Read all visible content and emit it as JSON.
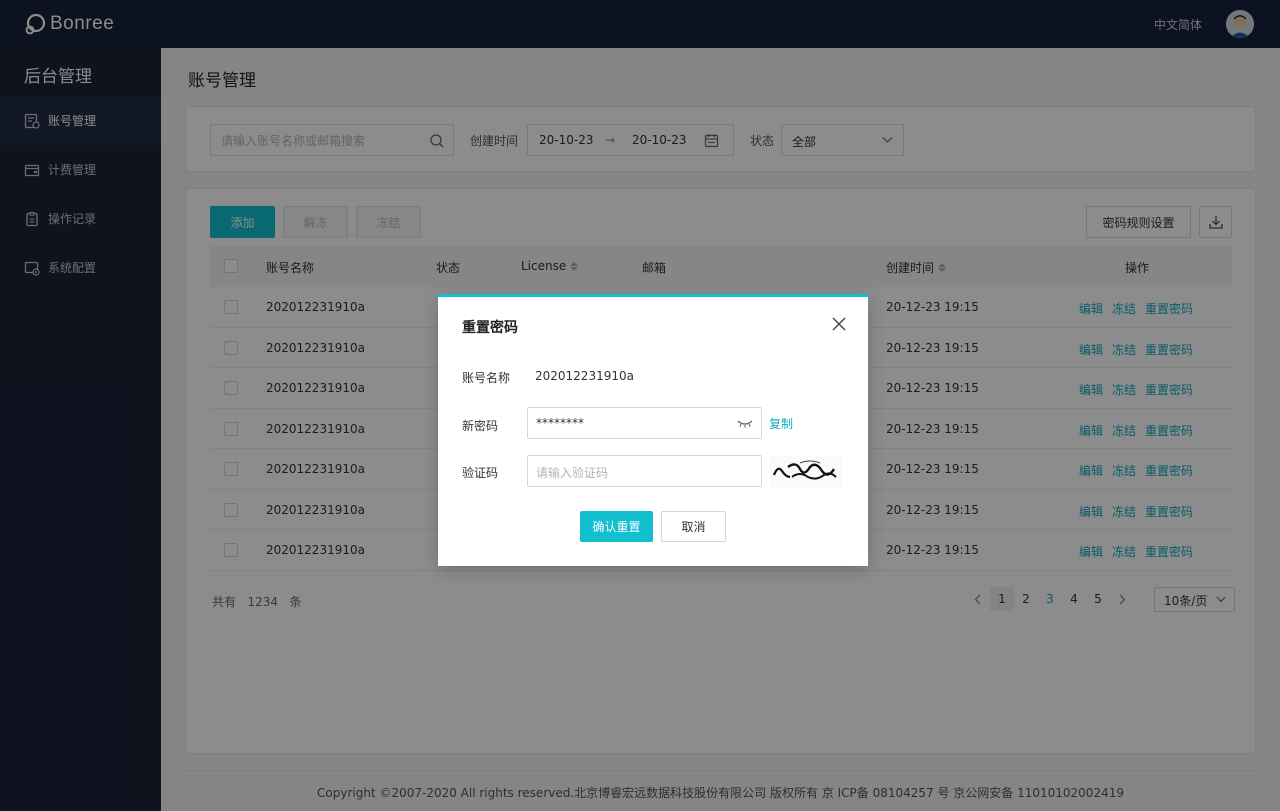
{
  "header": {
    "logo_text": "Bonree",
    "language": "中文简体"
  },
  "sidebar": {
    "title": "后台管理",
    "items": [
      {
        "label": "账号管理",
        "icon": "account-icon",
        "active": true
      },
      {
        "label": "计费管理",
        "icon": "wallet-icon",
        "active": false
      },
      {
        "label": "操作记录",
        "icon": "clipboard-icon",
        "active": false
      },
      {
        "label": "系统配置",
        "icon": "settings-icon",
        "active": false
      }
    ]
  },
  "main": {
    "title": "账号管理",
    "filters": {
      "search_placeholder": "请输入账号名称或邮箱搜索",
      "created_label": "创建时间",
      "date_start": "20-10-23",
      "date_sep": "→",
      "date_end": "20-10-23",
      "status_label": "状态",
      "status_value": "全部"
    },
    "toolbar": {
      "add": "添加",
      "unfreeze": "解冻",
      "freeze": "冻结",
      "password_rules": "密码规则设置"
    },
    "table": {
      "columns": [
        "账号名称",
        "状态",
        "License",
        "邮箱",
        "创建时间",
        "操作"
      ],
      "rows": [
        {
          "name": "202012231910a",
          "created": "20-12-23 19:15"
        },
        {
          "name": "202012231910a",
          "created": "20-12-23 19:15"
        },
        {
          "name": "202012231910a",
          "created": "20-12-23 19:15"
        },
        {
          "name": "202012231910a",
          "created": "20-12-23 19:15"
        },
        {
          "name": "202012231910a",
          "created": "20-12-23 19:15"
        },
        {
          "name": "202012231910a",
          "created": "20-12-23 19:15"
        },
        {
          "name": "202012231910a",
          "created": "20-12-23 19:15"
        }
      ],
      "actions": [
        "编辑",
        "冻结",
        "重置密码"
      ]
    },
    "pagination": {
      "total_prefix": "共有",
      "total": "1234",
      "total_suffix": "条",
      "pages": [
        "1",
        "2",
        "3",
        "4",
        "5"
      ],
      "current_page": "1",
      "page_size": "10条/页"
    },
    "footer": "Copyright ©2007-2020 All rights reserved.北京博睿宏远数据科技股份有限公司 版权所有 京 ICP备 08104257 号 京公网安备 11010102002419"
  },
  "modal": {
    "title": "重置密码",
    "account_label": "账号名称",
    "account_value": "202012231910a",
    "new_password_label": "新密码",
    "new_password_value": "********",
    "copy": "复制",
    "captcha_label": "验证码",
    "captcha_placeholder": "请输入验证码",
    "confirm": "确认重置",
    "cancel": "取消"
  },
  "colors": {
    "accent": "#12bfcf",
    "header_bg": "#16213a",
    "sidebar_bg": "#1b2338",
    "link": "#12aabd"
  }
}
